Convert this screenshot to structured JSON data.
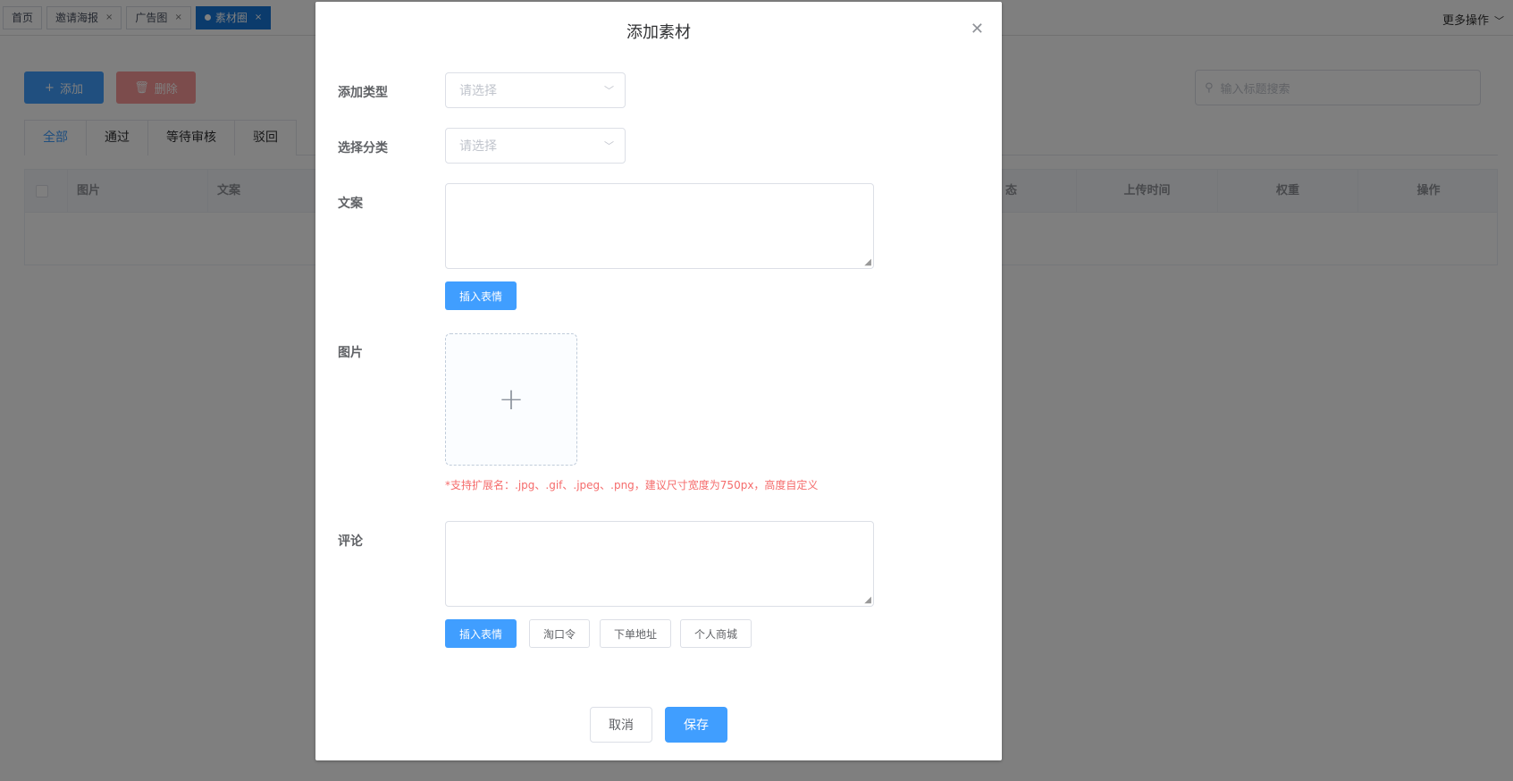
{
  "tags": [
    {
      "label": "首页",
      "closable": false,
      "active": false
    },
    {
      "label": "邀请海报",
      "closable": true,
      "active": false
    },
    {
      "label": "广告图",
      "closable": true,
      "active": false
    },
    {
      "label": "素材圈",
      "closable": true,
      "active": true
    }
  ],
  "tag_close_glyph": "×",
  "more_ops": "更多操作",
  "toolbar": {
    "add_label": "添加",
    "delete_label": "删除",
    "search_placeholder": "输入标题搜索"
  },
  "tabs": [
    "全部",
    "通过",
    "等待审核",
    "驳回"
  ],
  "table": {
    "headers": [
      "图片",
      "文案",
      "态",
      "上传时间",
      "权重",
      "操作"
    ]
  },
  "dialog": {
    "title": "添加素材",
    "fields": {
      "type_label": "添加类型",
      "type_placeholder": "请选择",
      "category_label": "选择分类",
      "category_placeholder": "请选择",
      "copy_label": "文案",
      "image_label": "图片",
      "comment_label": "评论"
    },
    "insert_emoji": "插入表情",
    "upload_hint": "*支持扩展名：.jpg、.gif、.jpeg、.png，建议尺寸宽度为750px，高度自定义",
    "comment_buttons": [
      "插入表情",
      "淘口令",
      "下单地址",
      "个人商城"
    ],
    "cancel_label": "取消",
    "save_label": "保存"
  },
  "colors": {
    "primary": "#409eff",
    "danger_light": "#f89898",
    "active_tag": "#1677d9",
    "hint_red": "#f56c6c"
  }
}
